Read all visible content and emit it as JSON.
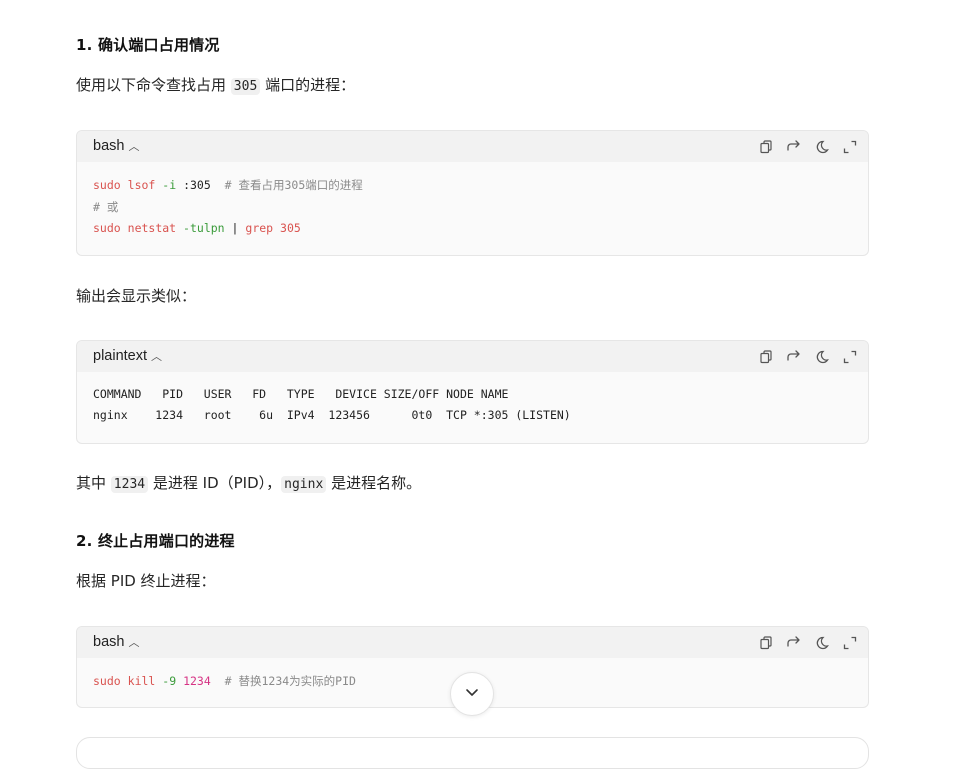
{
  "section1": {
    "title": "1. 确认端口占用情况",
    "intro_before": "使用以下命令查找占用",
    "intro_code": "305",
    "intro_after": "端口的进程："
  },
  "code1": {
    "lang": "bash",
    "line1": {
      "sudo": "sudo",
      "cmd": "lsof",
      "flag": "-i",
      "arg": ":305",
      "comment": "# 查看占用305端口的进程"
    },
    "line2": {
      "comment": "# 或"
    },
    "line3": {
      "sudo": "sudo",
      "cmd": "netstat",
      "flag": "-tulpn",
      "pipe": "|",
      "grep": "grep",
      "num": "305"
    }
  },
  "output_intro": "输出会显示类似：",
  "code2": {
    "lang": "plaintext",
    "line1": "COMMAND   PID   USER   FD   TYPE   DEVICE SIZE/OFF NODE NAME",
    "line2": "nginx    1234   root    6u  IPv4  123456      0t0  TCP *:305 (LISTEN)"
  },
  "pid_note": {
    "before": "其中",
    "code1": "1234",
    "middle": "是进程 ID（PID），",
    "code2": "nginx",
    "after": "是进程名称。"
  },
  "section2": {
    "title": "2. 终止占用端口的进程",
    "intro": "根据 PID 终止进程："
  },
  "code3": {
    "lang": "bash",
    "line1": {
      "sudo": "sudo",
      "cmd": "kill",
      "flag": "-9",
      "num": "1234",
      "comment": "# 替换1234为实际的PID"
    }
  },
  "icons": {
    "lang_toggle": "chevron-up-icon",
    "copy": "copy-icon",
    "wrap": "wrap-icon",
    "theme": "theme-moon-icon",
    "expand": "expand-icon",
    "scroll": "chevron-down-icon"
  },
  "colors": {
    "keyword_red": "#d9534f",
    "flag_green": "#3a9b3a",
    "number_pink": "#d63384",
    "comment_gray": "#8a8a8a"
  }
}
